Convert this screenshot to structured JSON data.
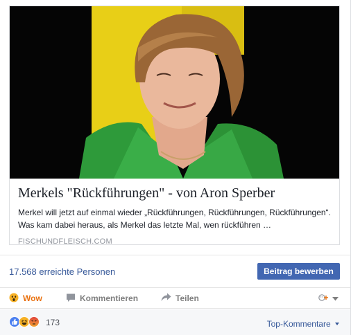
{
  "link_preview": {
    "title": "Merkels \"Rückführungen\" - von Aron Sperber",
    "description": "Merkel will jetzt auf einmal wieder „Rückführungen, Rückführungen, Rückführungen“. Was kam dabei heraus, als Merkel das letzte Mal, wen rückführen …",
    "domain": "FISCHUNDFLEISCH.COM",
    "image_subject": "woman-in-green-jacket-photo"
  },
  "reach": {
    "text": "17.568 erreichte Personen",
    "promote_label": "Beitrag bewerben"
  },
  "actions": {
    "wow_label": "Wow",
    "comment_label": "Kommentieren",
    "share_label": "Teilen"
  },
  "reactions": {
    "count": "173",
    "top_comments_label": "Top-Kommentare"
  },
  "colors": {
    "link_blue": "#365899",
    "button_blue": "#4267b2",
    "wow_orange": "#e9710f",
    "muted_gray": "#7f7f7f"
  }
}
